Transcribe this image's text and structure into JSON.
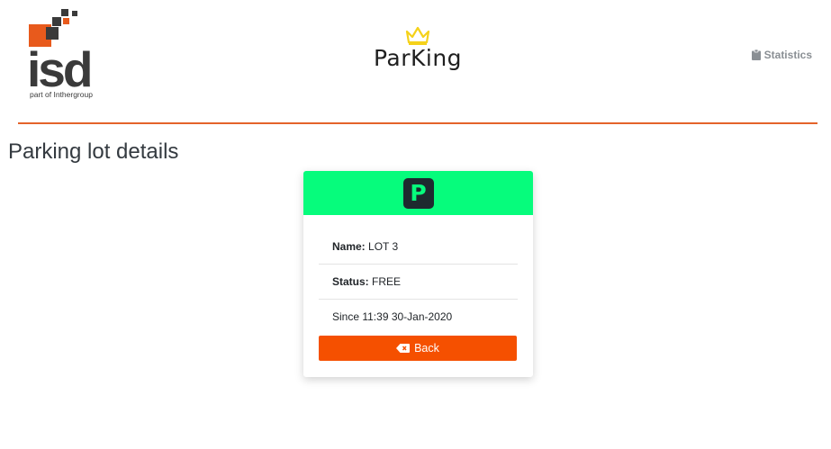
{
  "header": {
    "logo": {
      "text": "isd",
      "tagline": "part of Inthergroup"
    },
    "brand": {
      "name": "ParKing",
      "crown_color": "#f5d21a"
    },
    "stats_link": {
      "label": "Statistics",
      "icon": "clipboard-icon"
    }
  },
  "page": {
    "title": "Parking lot details"
  },
  "card": {
    "header_color": "#06fc7c",
    "icon": {
      "name": "parking-icon",
      "letter": "P"
    },
    "name_label": "Name:",
    "name_value": "LOT 3",
    "status_label": "Status:",
    "status_value": "FREE",
    "since_text": "Since 11:39 30-Jan-2020",
    "back_button": {
      "label": "Back",
      "icon": "backspace-icon",
      "color": "#f55000"
    }
  },
  "colors": {
    "accent": "#e4632a",
    "logo_orange": "#e85a1c",
    "logo_dark": "#3a3a3a"
  }
}
